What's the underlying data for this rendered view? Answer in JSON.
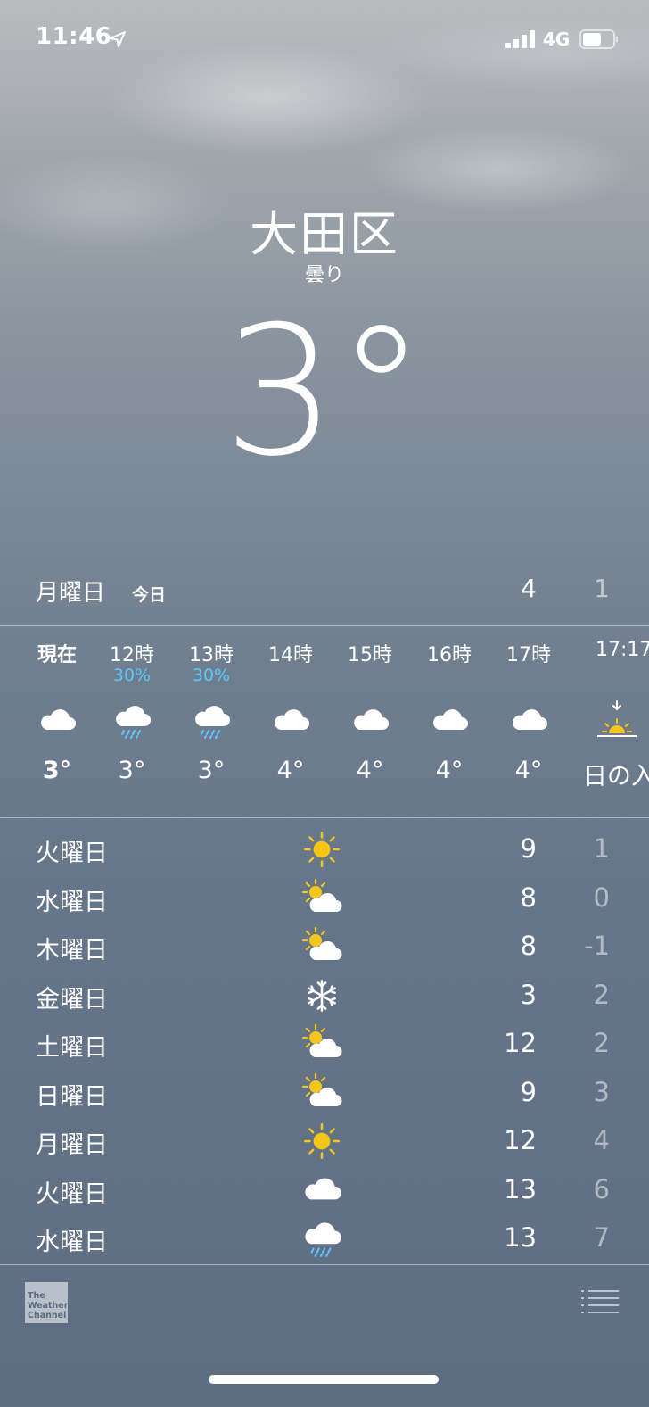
{
  "status_bar": {
    "time": "11:46",
    "network": "4G",
    "signal": "signal-bars-icon",
    "battery": "battery-icon"
  },
  "header": {
    "city": "大田区",
    "condition": "曇り",
    "temperature": "3°"
  },
  "today": {
    "day": "月曜日",
    "label": "今日",
    "high": "4",
    "low": "1"
  },
  "hourly": [
    {
      "label": "現在",
      "precip": "",
      "icon": "cloud-icon",
      "temp": "3°",
      "bold": true
    },
    {
      "label": "12時",
      "precip": "30%",
      "icon": "cloud-rain-icon",
      "temp": "3°"
    },
    {
      "label": "13時",
      "precip": "30%",
      "icon": "cloud-rain-icon",
      "temp": "3°"
    },
    {
      "label": "14時",
      "precip": "",
      "icon": "cloud-icon",
      "temp": "4°"
    },
    {
      "label": "15時",
      "precip": "",
      "icon": "cloud-icon",
      "temp": "4°"
    },
    {
      "label": "16時",
      "precip": "",
      "icon": "cloud-icon",
      "temp": "4°"
    },
    {
      "label": "17時",
      "precip": "",
      "icon": "cloud-icon",
      "temp": "4°"
    },
    {
      "label": "17:17",
      "precip": "",
      "icon": "sunset-icon",
      "temp": "日の入"
    }
  ],
  "daily": [
    {
      "day": "火曜日",
      "icon": "sun-icon",
      "high": "9",
      "low": "1"
    },
    {
      "day": "水曜日",
      "icon": "partly-cloudy-icon",
      "high": "8",
      "low": "0"
    },
    {
      "day": "木曜日",
      "icon": "partly-cloudy-icon",
      "high": "8",
      "low": "-1"
    },
    {
      "day": "金曜日",
      "icon": "snowflake-icon",
      "high": "3",
      "low": "2"
    },
    {
      "day": "土曜日",
      "icon": "partly-cloudy-icon",
      "high": "12",
      "low": "2"
    },
    {
      "day": "日曜日",
      "icon": "partly-cloudy-icon",
      "high": "9",
      "low": "3"
    },
    {
      "day": "月曜日",
      "icon": "sun-icon",
      "high": "12",
      "low": "4"
    },
    {
      "day": "火曜日",
      "icon": "cloud-icon",
      "high": "13",
      "low": "6"
    },
    {
      "day": "水曜日",
      "icon": "cloud-rain-icon",
      "high": "13",
      "low": "7"
    }
  ],
  "footer": {
    "logo_text": "The Weather Channel",
    "list_icon": "list-icon"
  },
  "colors": {
    "precip": "#5ac8fa",
    "sun": "#f5c518"
  }
}
